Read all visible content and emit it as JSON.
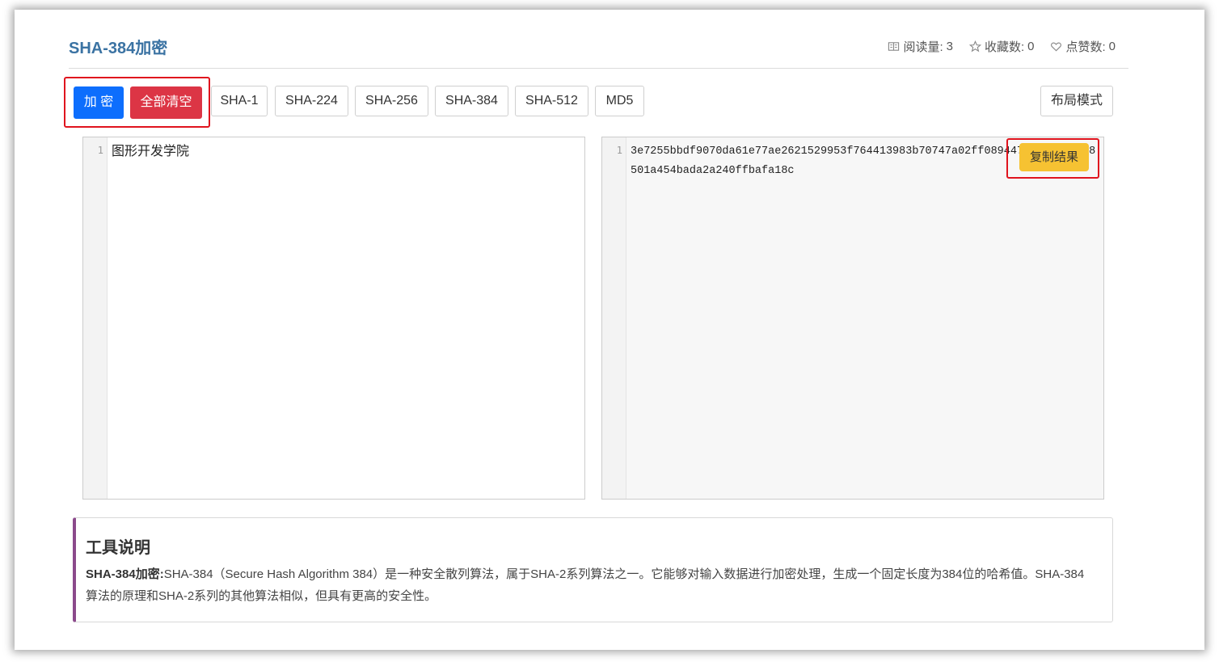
{
  "page": {
    "title": "SHA-384加密",
    "stats": {
      "views_label": "阅读量:",
      "views": "3",
      "favorites_label": "收藏数:",
      "favorites": "0",
      "likes_label": "点赞数:",
      "likes": "0"
    }
  },
  "toolbar": {
    "encrypt_label": "加 密",
    "clear_label": "全部清空",
    "algorithms": [
      "SHA-1",
      "SHA-224",
      "SHA-256",
      "SHA-384",
      "SHA-512",
      "MD5"
    ],
    "layout_label": "布局模式"
  },
  "input_editor": {
    "line_number": "1",
    "text": "图形开发学院"
  },
  "output_editor": {
    "line_number": "1",
    "text": "3e7255bbdf9070da61e77ae2621529953f764413983b70747a02ff0894479864bc4a1e8501a454bada2a240ffbafa18c",
    "copy_label": "复制结果"
  },
  "description": {
    "heading": "工具说明",
    "term": "SHA-384加密:",
    "text": "SHA-384（Secure Hash Algorithm 384）是一种安全散列算法，属于SHA-2系列算法之一。它能够对输入数据进行加密处理，生成一个固定长度为384位的哈希值。SHA-384算法的原理和SHA-2系列的其他算法相似，但具有更高的安全性。"
  },
  "colors": {
    "title": "#3b73a3",
    "primary": "#0d6efd",
    "danger": "#dc3545",
    "warning": "#f6c232",
    "highlight_box": "#e0141e",
    "desc_accent": "#8c4a8c"
  }
}
